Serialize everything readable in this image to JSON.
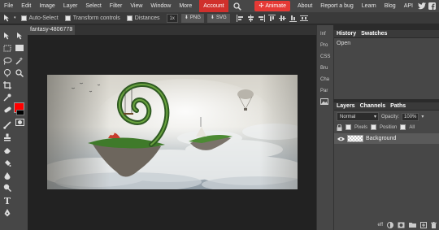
{
  "menu": {
    "items": [
      "File",
      "Edit",
      "Image",
      "Layer",
      "Select",
      "Filter",
      "View",
      "Window",
      "More"
    ],
    "account": "Account",
    "animate": "Animate",
    "right_links": [
      "About",
      "Report a bug",
      "Learn",
      "Blog",
      "API"
    ]
  },
  "options": {
    "auto_select": "Auto-Select",
    "transform_controls": "Transform controls",
    "distances": "Distances",
    "scale_value": "1x",
    "png": "PNG",
    "svg": "SVG"
  },
  "document": {
    "tab_title": "fantasy-4806773",
    "close": "×"
  },
  "mini_panels": [
    "Inf",
    "Pro",
    "CSS",
    "Bru",
    "Cha",
    "Par"
  ],
  "history": {
    "tabs": [
      "History",
      "Swatches"
    ],
    "entries": [
      "Open"
    ]
  },
  "layers": {
    "tabs": [
      "Layers",
      "Channels",
      "Paths"
    ],
    "blend_mode": "Normal",
    "opacity_label": "Opacity:",
    "opacity_value": "100%",
    "lock_label": "",
    "pixels": "Pixels",
    "position": "Position",
    "all": "All",
    "layer_names": [
      "Background"
    ],
    "footer_eff": "eff"
  },
  "colors": {
    "foreground": "#ff0000",
    "background": "#000000",
    "accent": "#d0302c"
  }
}
